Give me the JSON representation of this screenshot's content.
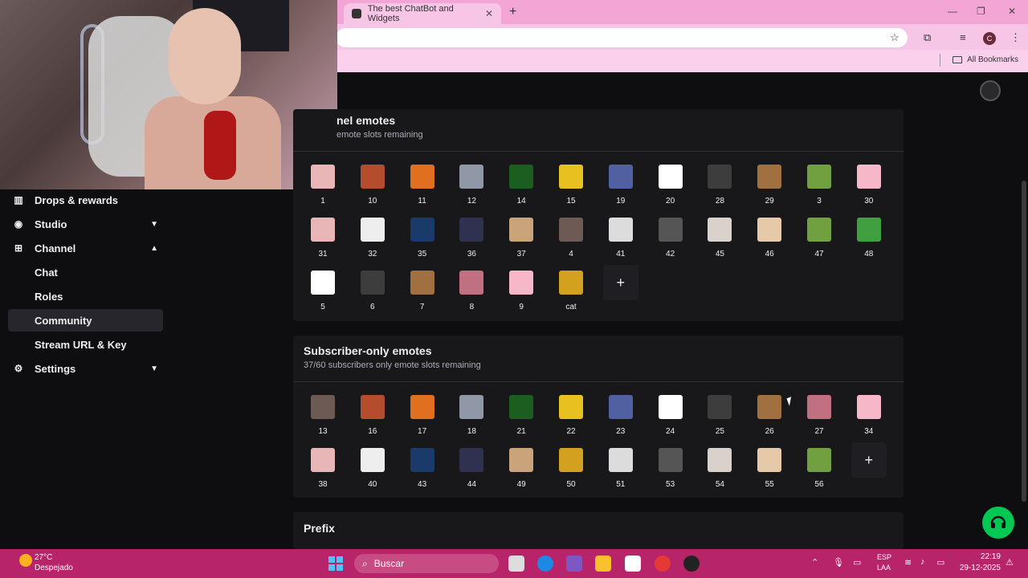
{
  "browser": {
    "tab_title": "The best ChatBot and Widgets",
    "bookmarks_label": "All Bookmarks",
    "profile_initial": "C"
  },
  "sidebar": {
    "items": [
      {
        "label": "Drops & rewards",
        "icon": "drops-icon"
      },
      {
        "label": "Studio",
        "icon": "studio-icon"
      },
      {
        "label": "Channel",
        "icon": "channel-icon"
      },
      {
        "label": "Chat"
      },
      {
        "label": "Roles"
      },
      {
        "label": "Community"
      },
      {
        "label": "Stream URL & Key"
      },
      {
        "label": "Settings",
        "icon": "gear-icon"
      }
    ]
  },
  "channel_emotes": {
    "title": "nel emotes",
    "subtitle": "emote slots remaining",
    "emotes": [
      "1",
      "10",
      "11",
      "12",
      "14",
      "15",
      "19",
      "20",
      "28",
      "29",
      "3",
      "30",
      "31",
      "32",
      "35",
      "36",
      "37",
      "4",
      "41",
      "42",
      "45",
      "46",
      "47",
      "48",
      "5",
      "6",
      "7",
      "8",
      "9",
      "cat"
    ]
  },
  "subscriber_emotes": {
    "title": "Subscriber-only emotes",
    "subtitle": "37/60 subscribers only emote slots remaining",
    "emotes": [
      "13",
      "16",
      "17",
      "18",
      "21",
      "22",
      "23",
      "24",
      "25",
      "26",
      "27",
      "34",
      "38",
      "40",
      "43",
      "44",
      "49",
      "50",
      "51",
      "53",
      "54",
      "55",
      "56"
    ]
  },
  "prefix": {
    "title": "Prefix"
  },
  "add_label": "+",
  "taskbar": {
    "temperature": "27°C",
    "weather": "Despejado",
    "search_placeholder": "Buscar",
    "lang_top": "ESP",
    "lang_bottom": "LAA",
    "time": "22:19",
    "date": "29-12-2025"
  },
  "colors": {
    "bg": "#0e0e10",
    "card": "#18181b",
    "accent_green": "#00c853",
    "taskbar": "#b8246a",
    "browser_chrome": "#f3a6d6"
  }
}
